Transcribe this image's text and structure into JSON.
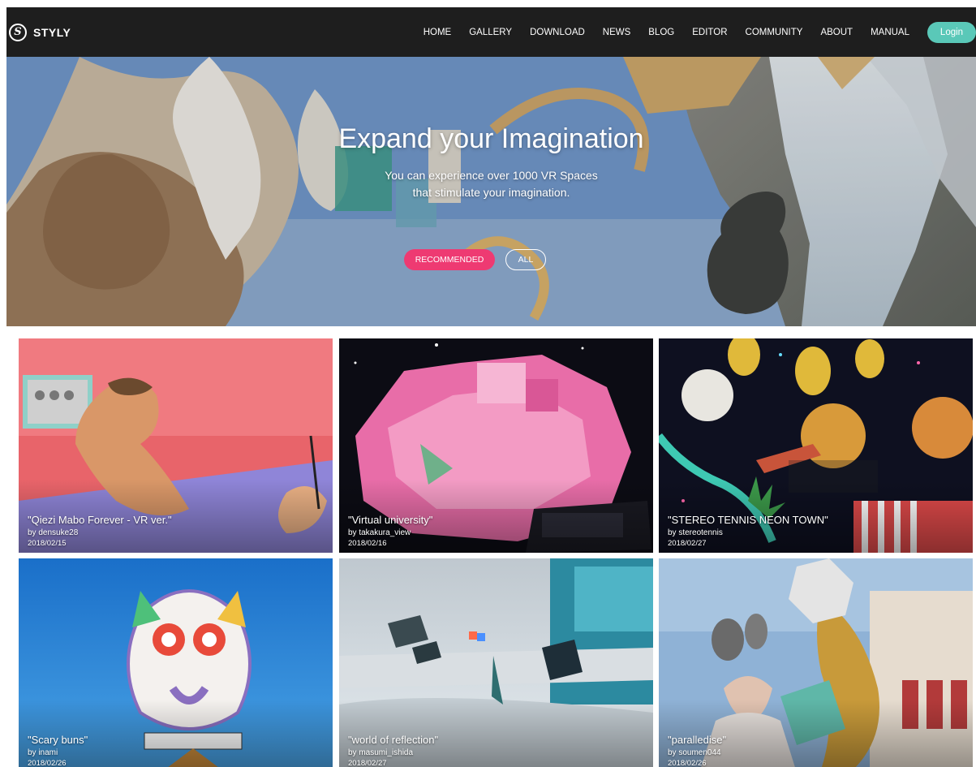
{
  "brand": {
    "name": "STYLY",
    "logo_glyph": "S"
  },
  "nav": {
    "items": [
      "HOME",
      "GALLERY",
      "DOWNLOAD",
      "NEWS",
      "BLOG",
      "EDITOR",
      "COMMUNITY",
      "ABOUT",
      "MANUAL"
    ],
    "login_label": "Login"
  },
  "hero": {
    "title": "Expand your Imagination",
    "subtitle_line1": "You can experience over 1000 VR Spaces",
    "subtitle_line2": "that stimulate your imagination.",
    "tabs": [
      "RECOMMENDED",
      "ALL"
    ]
  },
  "gallery": {
    "items": [
      {
        "title": "\"Qiezi Mabo Forever - VR ver.\"",
        "author": "by densuke28",
        "date": "2018/02/15"
      },
      {
        "title": "\"Virtual university\"",
        "author": "by takakura_view",
        "date": "2018/02/16"
      },
      {
        "title": "\"STEREO TENNIS NEON TOWN\"",
        "author": "by stereotennis",
        "date": "2018/02/27"
      },
      {
        "title": "\"Scary buns\"",
        "author": "by inami",
        "date": "2018/02/26"
      },
      {
        "title": "\"world of reflection\"",
        "author": "by masumi_ishida",
        "date": "2018/02/27"
      },
      {
        "title": "\"paralledise\"",
        "author": "by soumen044",
        "date": "2018/02/26"
      }
    ]
  },
  "colors": {
    "nav_bg": "#1e1e1e",
    "login_bg": "#5ac8b8",
    "recommended_bg": "#ee3a72"
  }
}
